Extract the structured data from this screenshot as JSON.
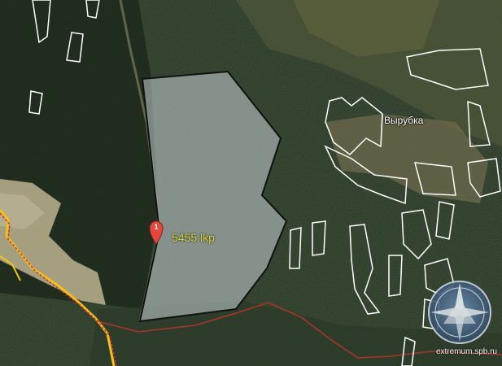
{
  "map": {
    "place_label": "Вырубка",
    "area_label": "5455 lkp",
    "marker_number": "1",
    "watermark_text": "extremum.spb.ru"
  },
  "colors": {
    "forest_dark": "#1e2a1c",
    "forest_mid": "#2a3826",
    "clearing": "#6e6d4e",
    "sand": "#a8a282",
    "polygon_fill": "#c9d2d6",
    "polygon_stroke": "#111111",
    "outline_white": "#ffffff",
    "road_yellow": "#f2c21b",
    "road_red": "#d0322a",
    "marker_red": "#e3483c",
    "label_yellow": "#d8d23a"
  },
  "icons": [
    "map-pin-icon",
    "compass-emblem-icon"
  ]
}
